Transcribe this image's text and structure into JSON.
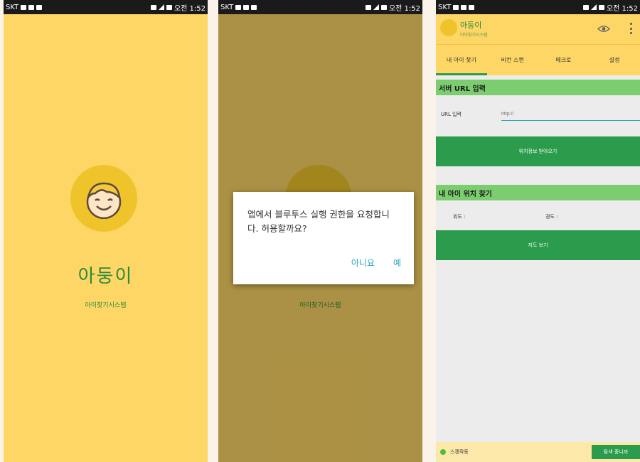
{
  "statusbar": {
    "carrier": "SKT",
    "time": "오전 1:52"
  },
  "splash": {
    "brand": "아둥이",
    "subtitle": "아이찾기시스템"
  },
  "dialog": {
    "message": "앱에서 블루투스 실행 권한을 요청합니다. 허용할까요?",
    "deny_label": "아니요",
    "allow_label": "예"
  },
  "app": {
    "header": {
      "brand": "아둥이",
      "subtitle": "아이찾기시스템"
    },
    "tabs": [
      {
        "label": "내 아이 찾기",
        "active": true
      },
      {
        "label": "비컨 스캔",
        "active": false
      },
      {
        "label": "메크로",
        "active": false
      },
      {
        "label": "설정",
        "active": false
      }
    ],
    "server_section": {
      "title": "서버 URL 입력",
      "url_label": "URL 입력",
      "url_placeholder": "http://",
      "fetch_button": "위치정보 받아오기"
    },
    "location_section": {
      "title": "내 아이 위치 찾기",
      "lat_label": "위도 :",
      "lng_label": "경도 :",
      "map_button": "지도 보기"
    },
    "bottom": {
      "status": "스캔작동",
      "scan_button": "탐색 중니까"
    }
  },
  "colors": {
    "yellow": "#fdd666",
    "green": "#2a9c4b",
    "section_green": "#7ccd6f",
    "accent_teal": "#2aa5b8"
  }
}
